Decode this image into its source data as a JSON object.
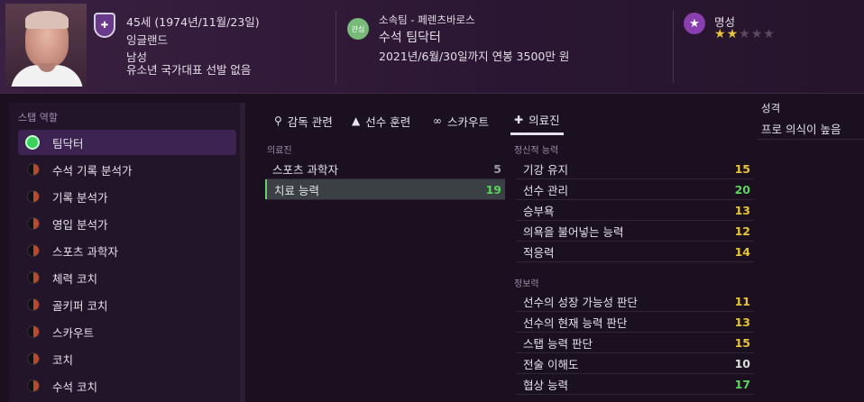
{
  "header": {
    "age": "45세 (1974년/11월/23일)",
    "nation": "잉글랜드",
    "gender": "남성",
    "youth": "유소년 국가대표 선발 없음",
    "club_badge": "관심",
    "club": "소속팀 - 페렌츠바로스",
    "role": "수석 팀닥터",
    "contract": "2021년/6월/30일까지 연봉 3500만 원",
    "reputation_label": "명성",
    "reputation_stars": 2,
    "reputation_max": 5
  },
  "staff_roles": {
    "title": "스탭 역할",
    "items": [
      {
        "label": "팀닥터",
        "active": true
      },
      {
        "label": "수석 기록 분석가",
        "active": false
      },
      {
        "label": "기록 분석가",
        "active": false
      },
      {
        "label": "영입 분석가",
        "active": false
      },
      {
        "label": "스포츠 과학자",
        "active": false
      },
      {
        "label": "체력 코치",
        "active": false
      },
      {
        "label": "골키퍼 코치",
        "active": false
      },
      {
        "label": "스카우트",
        "active": false
      },
      {
        "label": "코치",
        "active": false
      },
      {
        "label": "수석 코치",
        "active": false
      }
    ]
  },
  "tabs": [
    {
      "label": "감독 관련",
      "icon": "whistle-icon",
      "active": false
    },
    {
      "label": "선수 훈련",
      "icon": "cone-icon",
      "active": false
    },
    {
      "label": "스카우트",
      "icon": "binoculars-icon",
      "active": false
    },
    {
      "label": "의료진",
      "icon": "medical-kit-icon",
      "active": true
    }
  ],
  "medical": {
    "label": "의료진",
    "rows": [
      {
        "name": "스포츠 과학자",
        "value": "5",
        "color": "#9a9aa0"
      },
      {
        "name": "치료 능력",
        "value": "19",
        "color": "#5fd35f"
      }
    ]
  },
  "mental": {
    "label": "정신적 능력",
    "rows": [
      {
        "name": "기강 유지",
        "value": "15",
        "color": "#e6c53a"
      },
      {
        "name": "선수 관리",
        "value": "20",
        "color": "#5fd35f"
      },
      {
        "name": "승부욕",
        "value": "13",
        "color": "#e6c53a"
      },
      {
        "name": "의욕을 불어넣는 능력",
        "value": "12",
        "color": "#e6c53a"
      },
      {
        "name": "적응력",
        "value": "14",
        "color": "#e6c53a"
      }
    ]
  },
  "knowledge": {
    "label": "정보력",
    "rows": [
      {
        "name": "선수의 성장 가능성 판단",
        "value": "11",
        "color": "#e6c53a"
      },
      {
        "name": "선수의 현재 능력 판단",
        "value": "13",
        "color": "#e6c53a"
      },
      {
        "name": "스탭 능력 판단",
        "value": "15",
        "color": "#e6c53a"
      },
      {
        "name": "전술 이해도",
        "value": "10",
        "color": "#dcdcdc"
      },
      {
        "name": "협상 능력",
        "value": "17",
        "color": "#5fd35f"
      }
    ]
  },
  "personality": {
    "label": "성격",
    "value": "프로 의식이 높음"
  }
}
